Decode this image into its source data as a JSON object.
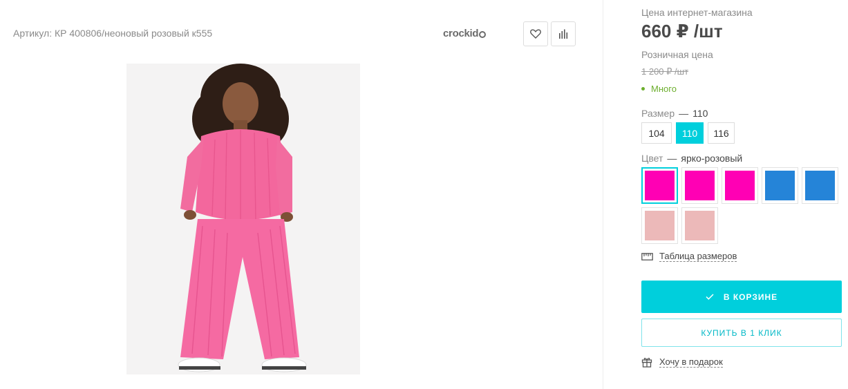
{
  "header": {
    "article": "Артикул: КР 400806/неоновый розовый к555",
    "brand": "crockid",
    "favorite_icon": "heart-icon",
    "compare_icon": "bar-chart-icon"
  },
  "product": {
    "image_label": "Girl wearing pink ribbed sweatshirt and wide trousers"
  },
  "pricing": {
    "online_label": "Цена интернет-магазина",
    "online_price": "660 ₽ /шт",
    "retail_label": "Розничная цена",
    "retail_price": "1 200 ₽ /шт",
    "stock": "Много"
  },
  "size": {
    "label": "Размер",
    "dash": "—",
    "selected": "110",
    "options": [
      "104",
      "110",
      "116"
    ]
  },
  "color": {
    "label": "Цвет",
    "dash": "—",
    "selected": "ярко-розовый",
    "swatches": [
      "#ff00b4",
      "#ff00b4",
      "#ff00b4",
      "#2584d8",
      "#2584d8",
      "#ecb9b9",
      "#ecb9b9"
    ]
  },
  "actions": {
    "size_table": "Таблица размеров",
    "cart": "В КОРЗИНЕ",
    "one_click": "КУПИТЬ В 1 КЛИК",
    "gift": "Хочу в подарок"
  },
  "colors": {
    "accent": "#00cfdc",
    "stock_green": "#6cae2d"
  }
}
